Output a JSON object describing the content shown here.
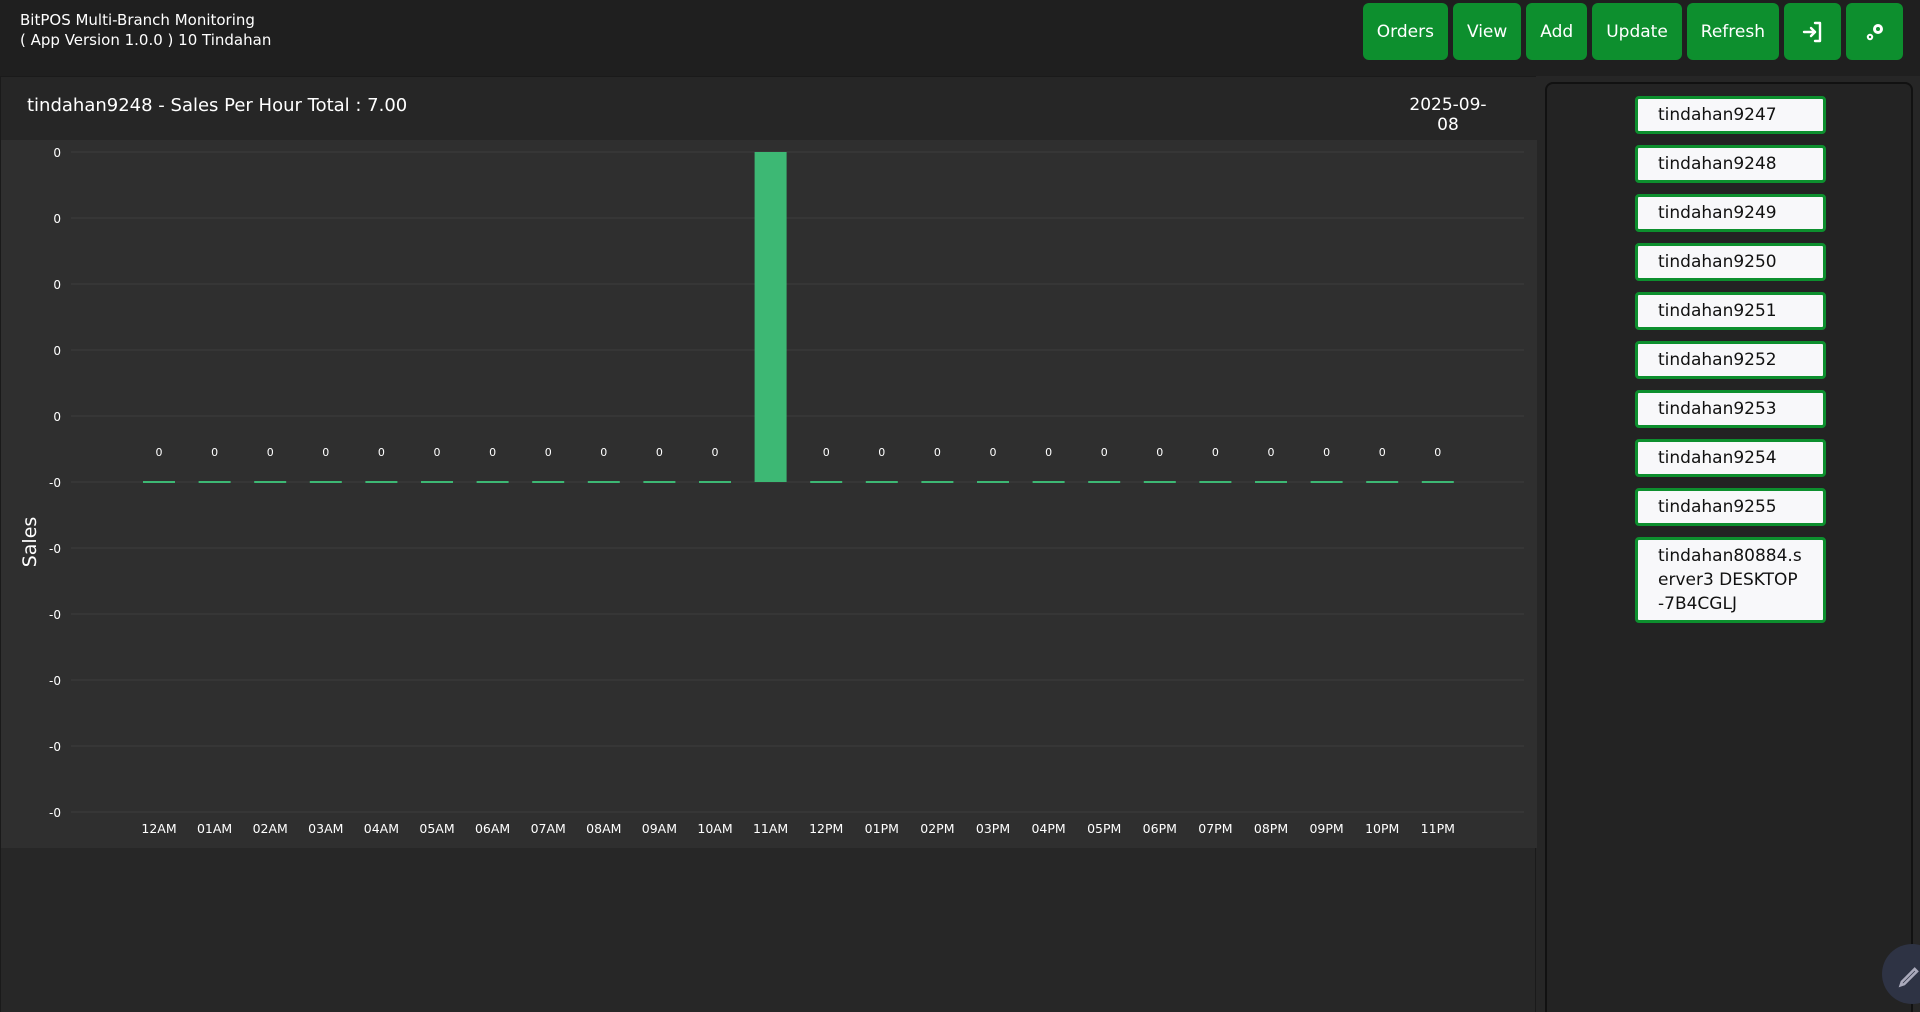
{
  "header": {
    "app_name": "BitPOS Multi-Branch Monitoring",
    "app_version": "( App Version 1.0.0 ) 10 Tindahan"
  },
  "toolbar": {
    "orders": "Orders",
    "view": "View",
    "add": "Add",
    "update": "Update",
    "refresh": "Refresh",
    "logout_icon": "logout-icon",
    "settings_icon": "gears-icon"
  },
  "chart_panel": {
    "title": "tindahan9248 -  Sales Per Hour Total : 7.00",
    "date": "2025-09-08"
  },
  "chart_data": {
    "type": "bar",
    "ylabel": "Sales",
    "xlabel": "",
    "categories": [
      "12AM",
      "01AM",
      "02AM",
      "03AM",
      "04AM",
      "05AM",
      "06AM",
      "07AM",
      "08AM",
      "09AM",
      "10AM",
      "11AM",
      "12PM",
      "01PM",
      "02PM",
      "03PM",
      "04PM",
      "05PM",
      "06PM",
      "07PM",
      "08PM",
      "09PM",
      "10PM",
      "11PM"
    ],
    "tick_labels": [
      "12AM",
      "01AM",
      "02AM",
      "03AM",
      "04AM",
      "05AM",
      "06AM",
      "07AM",
      "08AM",
      "09AM",
      "10AM",
      "11AM",
      "12PM",
      "01PM",
      "02PM",
      "03PM",
      "04PM",
      "05PM",
      "06PM",
      "07PM",
      "08PM",
      "09PM",
      "10PM",
      "11PM"
    ],
    "values": [
      0,
      0,
      0,
      0,
      0,
      0,
      0,
      0,
      0,
      0,
      0,
      7,
      0,
      0,
      0,
      0,
      0,
      0,
      0,
      0,
      0,
      0,
      0,
      0
    ],
    "data_labels": [
      "0",
      "0",
      "0",
      "0",
      "0",
      "0",
      "0",
      "0",
      "0",
      "0",
      "0",
      "",
      "0",
      "0",
      "0",
      "0",
      "0",
      "0",
      "0",
      "0",
      "0",
      "0",
      "0",
      "0"
    ],
    "y_tick_labels": [
      "0",
      "0",
      "0",
      "0",
      "0",
      "-0",
      "-0",
      "-0",
      "-0",
      "-0",
      "-0"
    ],
    "ylim": [
      -7,
      7
    ],
    "color": "#3db874",
    "grid": true
  },
  "branches": [
    {
      "label": "tindahan9247"
    },
    {
      "label": "tindahan9248"
    },
    {
      "label": "tindahan9249"
    },
    {
      "label": "tindahan9250"
    },
    {
      "label": "tindahan9251"
    },
    {
      "label": "tindahan9252"
    },
    {
      "label": "tindahan9253"
    },
    {
      "label": "tindahan9254"
    },
    {
      "label": "tindahan9255"
    },
    {
      "label": "tindahan80884.server3 DESKTOP-7B4CGLJ"
    }
  ],
  "fab": {
    "icon": "pencil-icon"
  }
}
